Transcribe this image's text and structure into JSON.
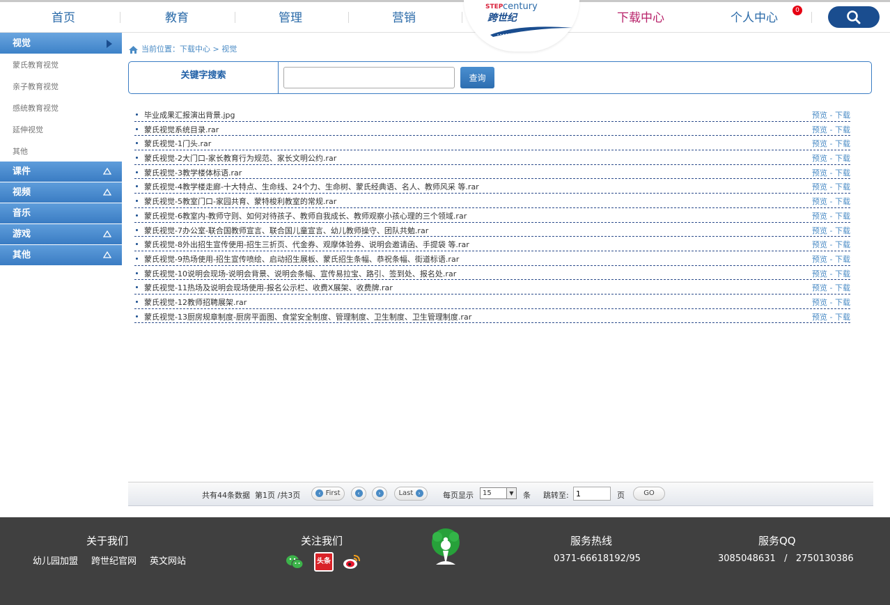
{
  "nav": {
    "items": [
      "首页",
      "教育",
      "管理",
      "营销",
      "下载中心",
      "个人中心"
    ],
    "active_color": "#b8226a",
    "badge_count": "0"
  },
  "logo": {
    "step": "STEP",
    "century": "century",
    "cn": "跨世纪"
  },
  "sidebar": {
    "active_section": "视觉",
    "sub_items": [
      "蒙氏教育视觉",
      "亲子教育视觉",
      "感统教育视觉",
      "延伸视觉",
      "其他"
    ],
    "groups": [
      {
        "label": "课件",
        "has_arrow": true
      },
      {
        "label": "视频",
        "has_arrow": true
      },
      {
        "label": "音乐",
        "has_arrow": false
      },
      {
        "label": "游戏",
        "has_arrow": true
      },
      {
        "label": "其他",
        "has_arrow": true
      }
    ]
  },
  "breadcrumb": {
    "text": "当前位置：下载中心 > 视觉"
  },
  "search": {
    "label": "关键字搜索",
    "value": "",
    "button": "查询"
  },
  "files": [
    "毕业成果汇报演出背景.jpg",
    "蒙氏视觉系统目录.rar",
    "蒙氏视觉-1门头.rar",
    "蒙氏视觉-2大门口-家长教育行为规范、家长文明公约.rar",
    "蒙氏视觉-3教学楼体标语.rar",
    "蒙氏视觉-4教学楼走廊-十大特点、生命线、24个力、生命树、蒙氏经典语、名人、教师风采 等.rar",
    "蒙氏视觉-5教室门口-家园共育、蒙特梭利教室的常规.rar",
    "蒙氏视觉-6教室内-教师守则、如何对待孩子、教师自我成长、教师观察小孩心理的三个领域.rar",
    "蒙氏视觉-7办公室-联合国教师宣言、联合国儿童宣言、幼儿教师操守、团队共勉.rar",
    "蒙氏视觉-8外出招生宣传使用-招生三折页、代金券、观摩体验券、说明会邀请函、手提袋 等.rar",
    "蒙氏视觉-9热场使用-招生宣传喷绘、启动招生展板、蒙氏招生条幅、恭祝条幅、街道标语.rar",
    "蒙氏视觉-10说明会现场-说明会背景、说明会条幅、宣传易拉宝、路引、签到处、报名处.rar",
    "蒙氏视觉-11热场及说明会现场使用-报名公示栏、收费X展架、收费牌.rar",
    "蒙氏视觉-12教师招聘展架.rar",
    "蒙氏视觉-13厨房规章制度-厨房平面图、食堂安全制度、管理制度、卫生制度、卫生管理制度.rar"
  ],
  "file_actions": {
    "preview": "预览",
    "sep": " - ",
    "download": "下载"
  },
  "pager": {
    "summary": "共有44条数据",
    "page_info": "第1页 /共3页",
    "first": "First",
    "last": "Last",
    "per_page_label": "每页显示",
    "per_page_value": "15",
    "unit": "条",
    "jump_label": "跳转至:",
    "jump_value": "1",
    "page_unit": "页",
    "go": "GO"
  },
  "footer": {
    "about_title": "关于我们",
    "about_links": [
      "幼儿园加盟",
      "跨世纪官网",
      "英文网站"
    ],
    "follow_title": "关注我们",
    "toutiao_label": "头条",
    "hotline_title": "服务热线",
    "hotline": "0371-66618192/95",
    "qq_title": "服务QQ",
    "qq": "3085048631   /   2750130386"
  }
}
